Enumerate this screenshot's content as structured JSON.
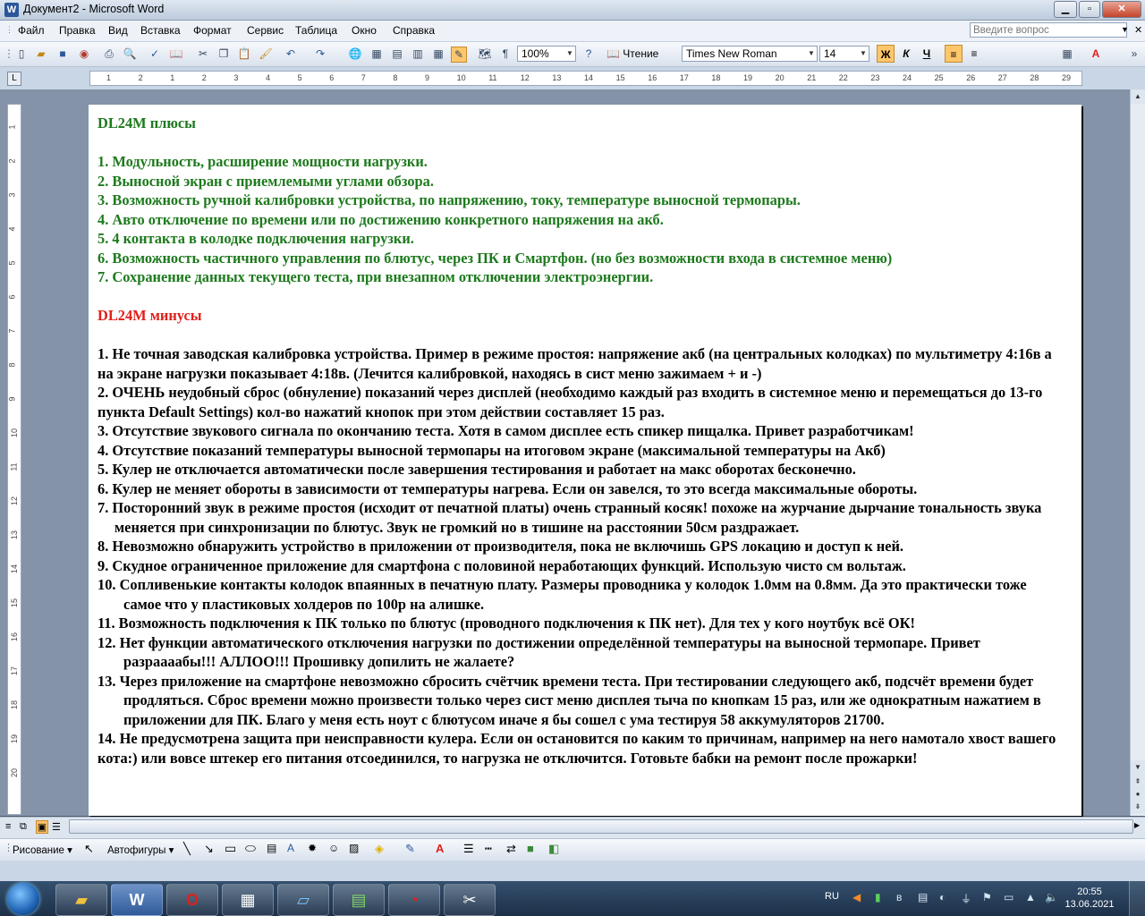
{
  "window": {
    "title": "Документ2 - Microsoft Word",
    "app_icon": "W"
  },
  "menu": [
    "Файл",
    "Правка",
    "Вид",
    "Вставка",
    "Формат",
    "Сервис",
    "Таблица",
    "Окно",
    "Справка"
  ],
  "help_placeholder": "Введите вопрос",
  "toolbar": {
    "zoom": "100%",
    "reading_label": "Чтение",
    "font": "Times New Roman",
    "size": "14",
    "bold": "Ж",
    "italic": "К",
    "underline": "Ч"
  },
  "ruler": {
    "numbers": [
      "1",
      "2",
      "1",
      "2",
      "3",
      "4",
      "5",
      "6",
      "7",
      "8",
      "9",
      "10",
      "11",
      "12",
      "13",
      "14",
      "15",
      "16",
      "17",
      "18",
      "19",
      "20",
      "21",
      "22",
      "23",
      "24",
      "25",
      "26",
      "27",
      "28",
      "29"
    ],
    "vnumbers": [
      "1",
      "2",
      "3",
      "4",
      "5",
      "6",
      "7",
      "8",
      "9",
      "10",
      "11",
      "12",
      "13",
      "14",
      "15",
      "16",
      "17",
      "18",
      "19",
      "20"
    ]
  },
  "document": {
    "plus_heading": "DL24M плюсы",
    "plus_items": [
      "1.  Модульность, расширение мощности нагрузки.",
      "2.  Выносной экран с приемлемыми углами обзора.",
      "3.  Возможность ручной калибровки устройства, по напряжению, току, температуре выносной термопары.",
      "4. Авто отключение по времени или по достижению конкретного напряжения на акб.",
      "5. 4 контакта в колодке подключения нагрузки.",
      "6. Возможность частичного управления по блютус, через ПК и Смартфон. (но без возможности входа в системное меню)",
      "7. Сохранение данных текущего теста, при внезапном отключении электроэнергии."
    ],
    "minus_heading": "DL24M минусы",
    "minus_items": [
      "1. Не точная заводская калибровка устройства. Пример в режиме простоя: напряжение акб (на центральных колодках) по мультиметру 4:16в а на экране нагрузки показывает 4:18в. (Лечится калибровкой, находясь в сист меню зажимаем + и -)",
      "2. ОЧЕНЬ неудобный сброс (обнуление) показаний через дисплей (необходимо каждый раз входить в системное меню и перемещаться до 13-го пункта Default Settings) кол-во нажатий кнопок при этом действии составляет 15 раз.",
      "3. Отсутствие звукового сигнала по окончанию теста. Хотя в самом дисплее есть спикер пищалка. Привет разработчикам!",
      "4. Отсутствие показаний температуры выносной термопары на итоговом экране (максимальной температуры на Акб)",
      "5. Кулер не отключается автоматически после завершения тестирования и работает на макс оборотах бесконечно.",
      "6. Кулер не меняет обороты в зависимости от температуры нагрева. Если он завелся, то это всегда максимальные обороты.",
      "7. Посторонний звук в режиме простоя (исходит от печатной платы) очень странный косяк! похоже на журчание дырчание тональность звука меняется при синхронизации по блютус. Звук не громкий но в тишине на расстоянии 50см раздражает.",
      "8. Невозможно обнаружить устройство в приложении от производителя, пока не включишь GPS локацию и доступ к ней.",
      "9. Скудное ограниченное приложение для смартфона с половиной неработающих функций. Использую чисто см вольтаж.",
      "10. Сопливенькие контакты колодок впаянных в печатную плату. Размеры проводника у колодок 1.0мм на 0.8мм. Да это практически тоже самое что у пластиковых холдеров по 100р на алишке.",
      "11. Возможность подключения к ПК только по блютус (проводного подключения к ПК нет). Для тех у кого ноутбук всё ОК!",
      "12. Нет функции автоматического отключения нагрузки по достижении определённой температуры на выносной термопаре. Привет разраааабы!!! АЛЛОО!!! Прошивку допилить не жалаете?",
      "13. Через приложение на смартфоне невозможно сбросить счётчик времени теста. При тестировании следующего акб, подсчёт времени будет продляться. Сброс времени можно произвести только через сист меню дисплея тыча по кнопкам 15 раз, или же однократным нажатием в приложении для ПК. Благо у меня есть ноут с блютусом иначе я бы сошел с ума тестируя 58 аккумуляторов 21700.",
      "14. Не предусмотрена защита при неисправности кулера. Если он остановится по каким то причинам, например на него намотало хвост вашего кота:) или вовсе штекер его питания отсоединился, то нагрузка не отключится. Готовьте бабки на ремонт после прожарки!"
    ]
  },
  "drawbar": {
    "drawing_label": "Рисование",
    "autoshapes_label": "Автофигуры"
  },
  "taskbar": {
    "lang": "RU",
    "time": "20:55",
    "date": "13.06.2021"
  },
  "colors": {
    "plus_green": "#1d7a1d",
    "minus_red": "#e0201a"
  }
}
